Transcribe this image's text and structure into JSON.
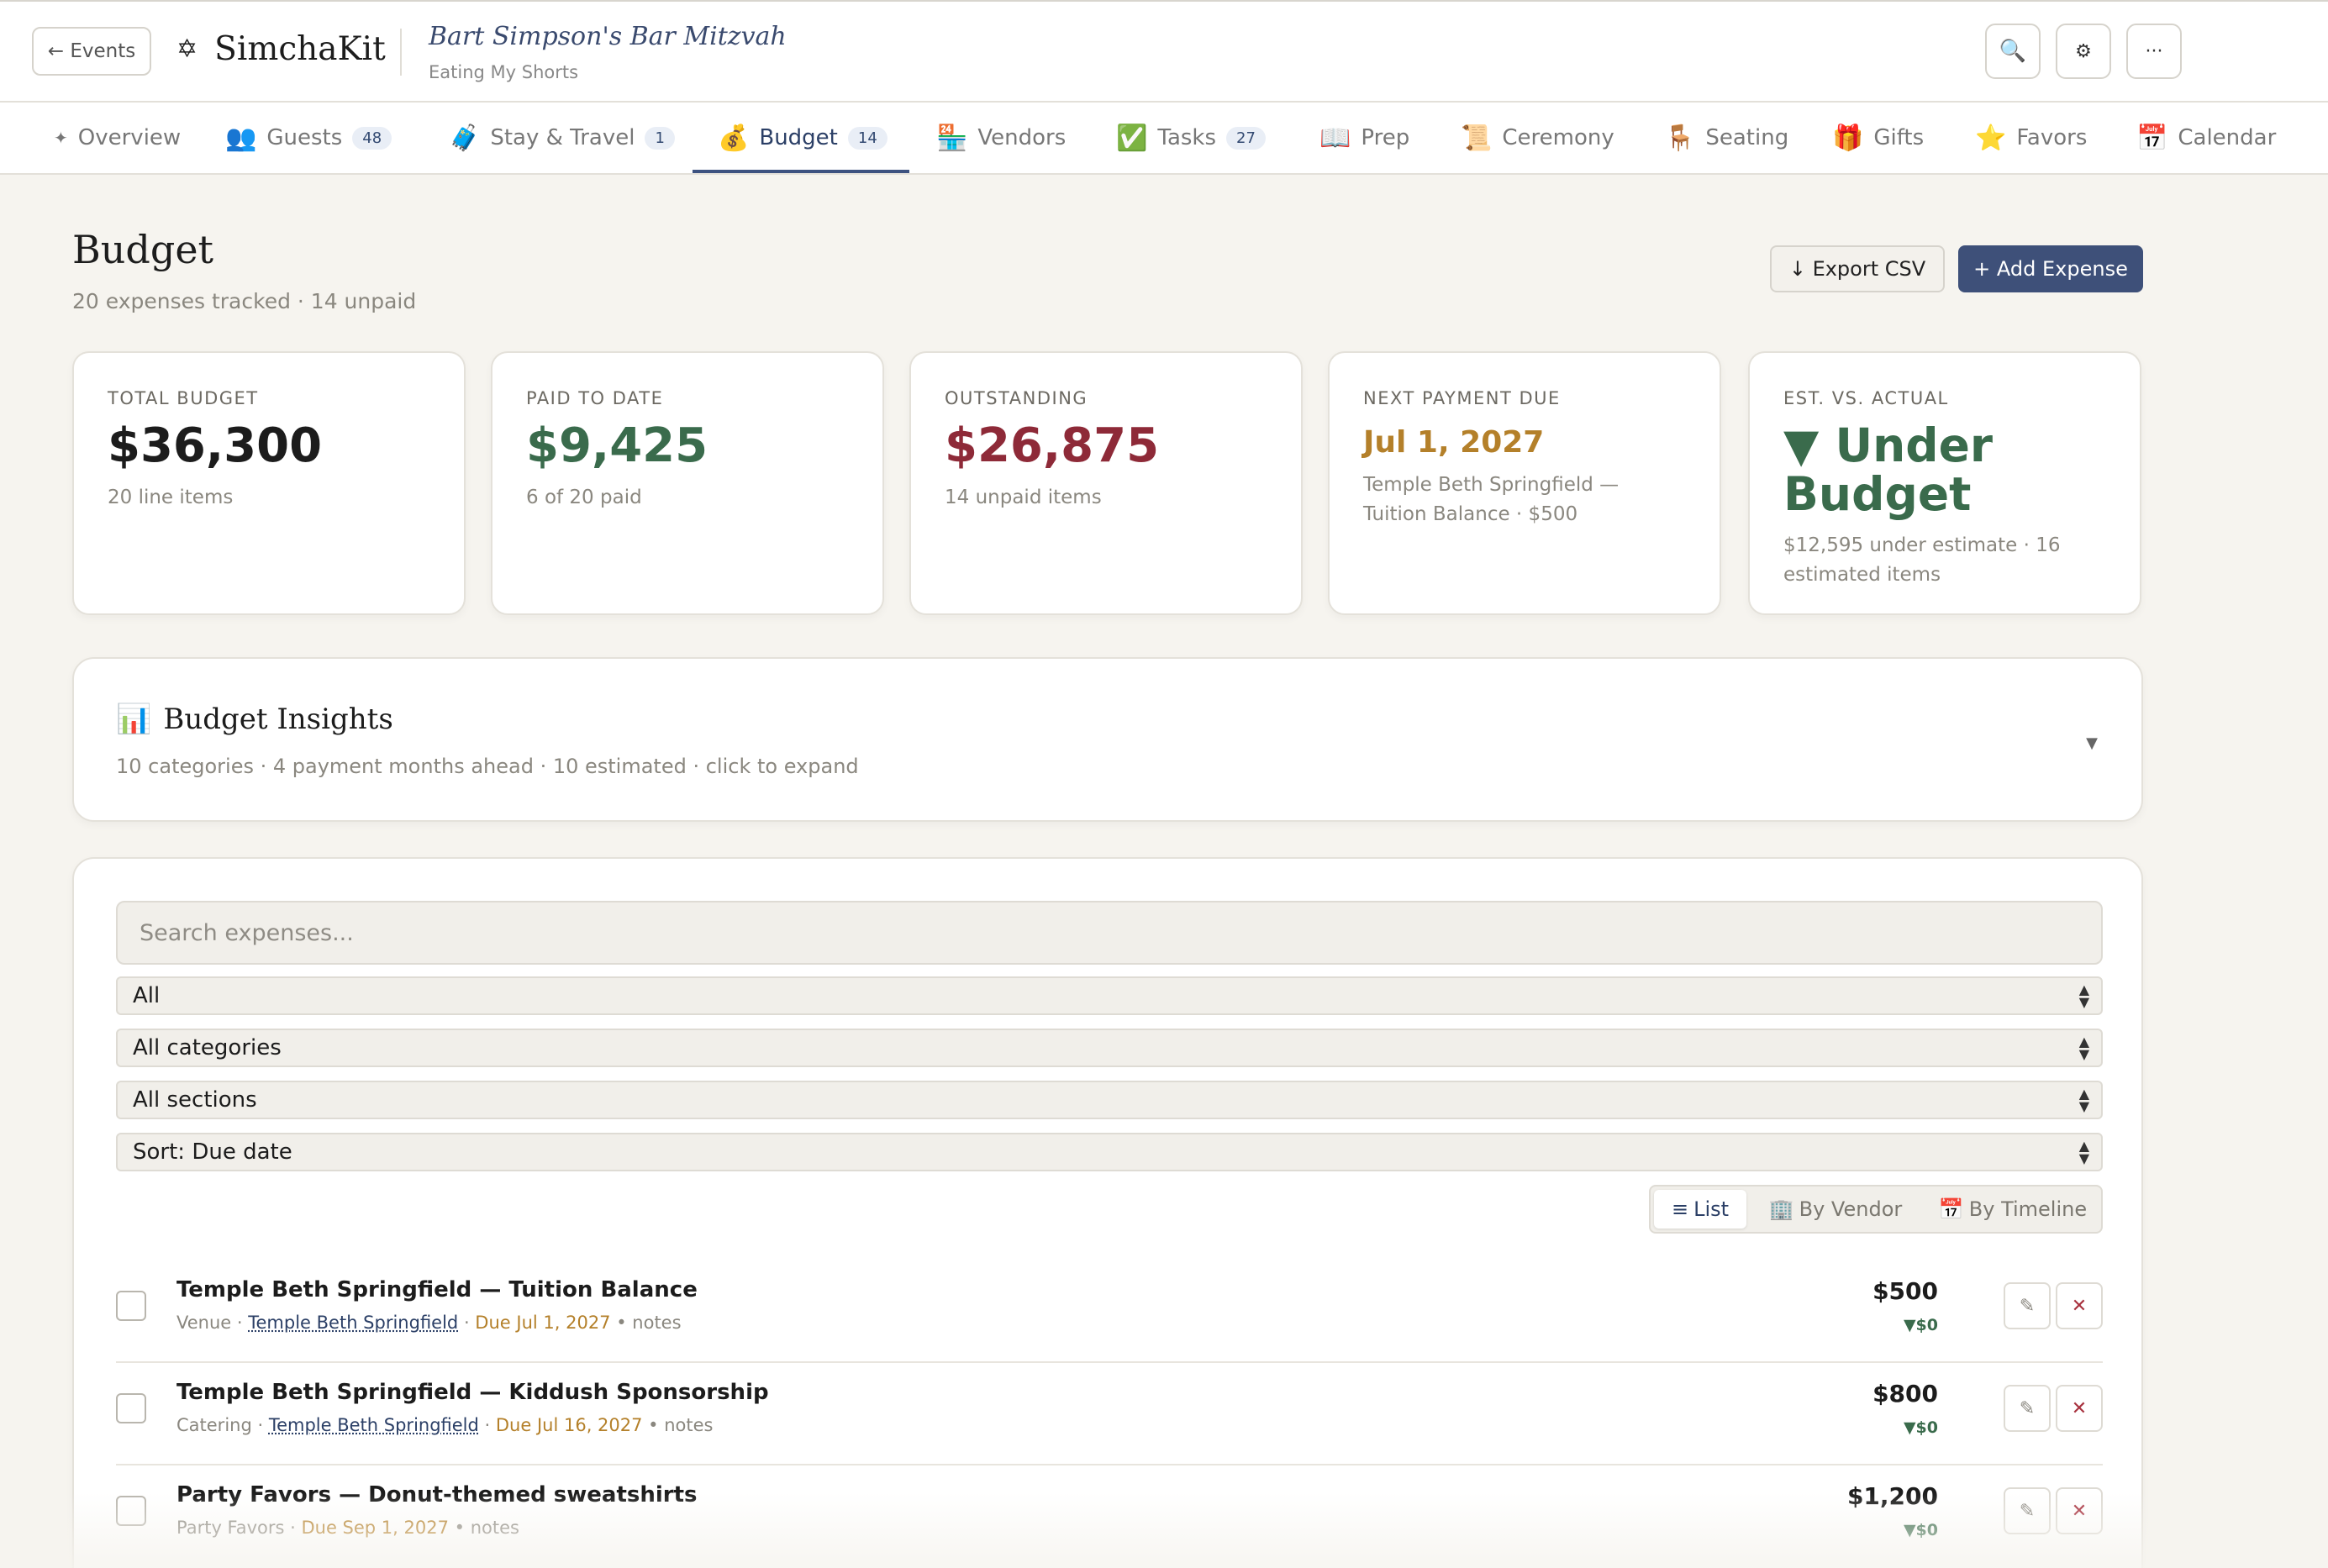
{
  "topbar": {
    "back_label": "← Events",
    "brand_icon": "✡",
    "brand_name": "SimchaKit",
    "event_title": "Bart Simpson's Bar Mitzvah",
    "event_subtitle": "Eating My Shorts",
    "search_icon": "🔍",
    "settings_icon": "⚙",
    "more_icon": "···"
  },
  "tabs": [
    {
      "icon": "✦",
      "label": "Overview",
      "badge": ""
    },
    {
      "icon": "👥",
      "label": "Guests",
      "badge": "48"
    },
    {
      "icon": "🧳",
      "label": "Stay & Travel",
      "badge": "1"
    },
    {
      "icon": "💰",
      "label": "Budget",
      "badge": "14"
    },
    {
      "icon": "🏪",
      "label": "Vendors",
      "badge": ""
    },
    {
      "icon": "✅",
      "label": "Tasks",
      "badge": "27"
    },
    {
      "icon": "📖",
      "label": "Prep",
      "badge": ""
    },
    {
      "icon": "📜",
      "label": "Ceremony",
      "badge": ""
    },
    {
      "icon": "🪑",
      "label": "Seating",
      "badge": ""
    },
    {
      "icon": "🎁",
      "label": "Gifts",
      "badge": ""
    },
    {
      "icon": "⭐",
      "label": "Favors",
      "badge": ""
    },
    {
      "icon": "📅",
      "label": "Calendar",
      "badge": ""
    }
  ],
  "page": {
    "title": "Budget",
    "subtitle": "20 expenses tracked · 14 unpaid",
    "export_label": "↓ Export CSV",
    "add_label": "+ Add Expense"
  },
  "cards": [
    {
      "label": "TOTAL BUDGET",
      "value": "$36,300",
      "note": "20 line items",
      "color": "#1c1c1c"
    },
    {
      "label": "PAID TO DATE",
      "value": "$9,425",
      "note": "6 of 20 paid",
      "color": "#3a6b4c"
    },
    {
      "label": "OUTSTANDING",
      "value": "$26,875",
      "note": "14 unpaid items",
      "color": "#8e2a38"
    },
    {
      "label": "NEXT PAYMENT DUE",
      "value": "Jul 1, 2027",
      "note": "Temple Beth Springfield — Tuition Balance · $500",
      "color": "#b4802a"
    },
    {
      "label": "EST. VS. ACTUAL",
      "value": "▼ Under Budget",
      "note": "$12,595 under estimate · 16 estimated items",
      "color": "#3a6b4c"
    }
  ],
  "insights": {
    "icon": "📊",
    "title": "Budget Insights",
    "subtitle": "10 categories · 4 payment months ahead · 10 estimated · click to expand",
    "caret": "▼"
  },
  "filters": {
    "search_placeholder": "Search expenses...",
    "status": "All",
    "category": "All categories",
    "section": "All sections",
    "sort": "Sort: Due date"
  },
  "views": [
    {
      "icon": "≡",
      "label": "List"
    },
    {
      "icon": "🏢",
      "label": "By Vendor"
    },
    {
      "icon": "📅",
      "label": "By Timeline"
    }
  ],
  "expenses": [
    {
      "title": "Temple Beth Springfield — Tuition Balance",
      "category": "Venue",
      "sep1": " · ",
      "vendor": "Temple Beth Springfield",
      "sep2": " · ",
      "due": "Due Jul 1, 2027",
      "notes": " • notes",
      "amount": "$500",
      "variance": "▼$0"
    },
    {
      "title": "Temple Beth Springfield — Kiddush Sponsorship",
      "category": "Catering",
      "sep1": " · ",
      "vendor": "Temple Beth Springfield",
      "sep2": " · ",
      "due": "Due Jul 16, 2027",
      "notes": " • notes",
      "amount": "$800",
      "variance": "▼$0"
    },
    {
      "title": "Party Favors — Donut-themed sweatshirts",
      "category": "Party Favors",
      "sep1": "",
      "vendor": "",
      "sep2": " · ",
      "due": "Due Sep 1, 2027",
      "notes": " • notes",
      "amount": "$1,200",
      "variance": "▼$0"
    }
  ],
  "row_actions": {
    "edit_icon": "✎",
    "delete_icon": "✕"
  }
}
